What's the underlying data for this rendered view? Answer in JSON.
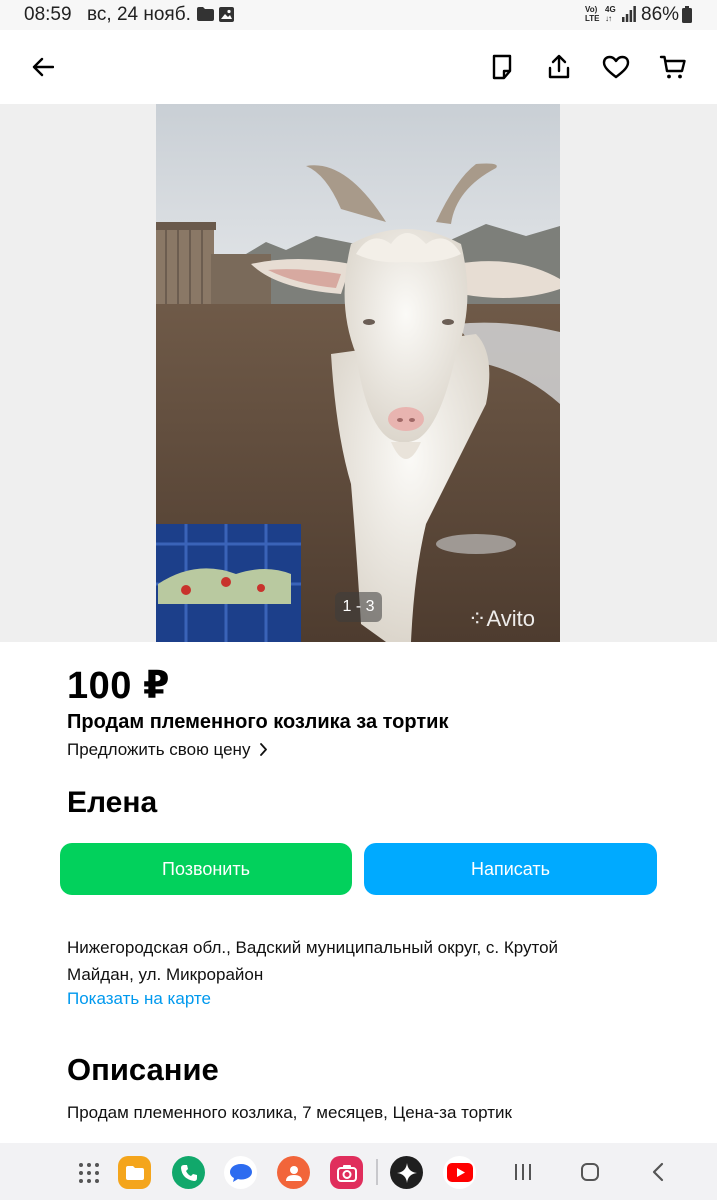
{
  "status_bar": {
    "time": "08:59",
    "date": "вс, 24 нояб.",
    "network_top": "Vo)",
    "network_bottom": "LTE",
    "signal_gen": "4G",
    "battery": "86%"
  },
  "header": {
    "icons": [
      "back-arrow-icon",
      "note-icon",
      "share-icon",
      "heart-icon",
      "cart-icon"
    ]
  },
  "gallery": {
    "counter": "1 - 3",
    "watermark": "Avito"
  },
  "listing": {
    "price": "100 ₽",
    "title": "Продам племенного козлика за тортик",
    "offer_price": "Предложить свою цену",
    "seller_name": "Елена",
    "call_button": "Позвонить",
    "write_button": "Написать",
    "address": "Нижегородская обл., Вадский муниципальный округ, с. Крутой Майдан, ул. Микрорайон",
    "show_on_map": "Показать на карте",
    "description_heading": "Описание",
    "description_text": "Продам племенного козлика, 7 месяцев, Цена-за тортик"
  },
  "colors": {
    "call": "#02d15c",
    "write": "#00aaff",
    "link": "#0099ee"
  },
  "dock": {
    "apps": [
      "apps-grid-icon",
      "files-app-icon",
      "phone-app-icon",
      "messages-app-icon",
      "contacts-app-icon",
      "camera-app-icon",
      "gemini-app-icon",
      "youtube-app-icon"
    ],
    "nav": [
      "recents-icon",
      "home-icon",
      "back-icon"
    ]
  }
}
